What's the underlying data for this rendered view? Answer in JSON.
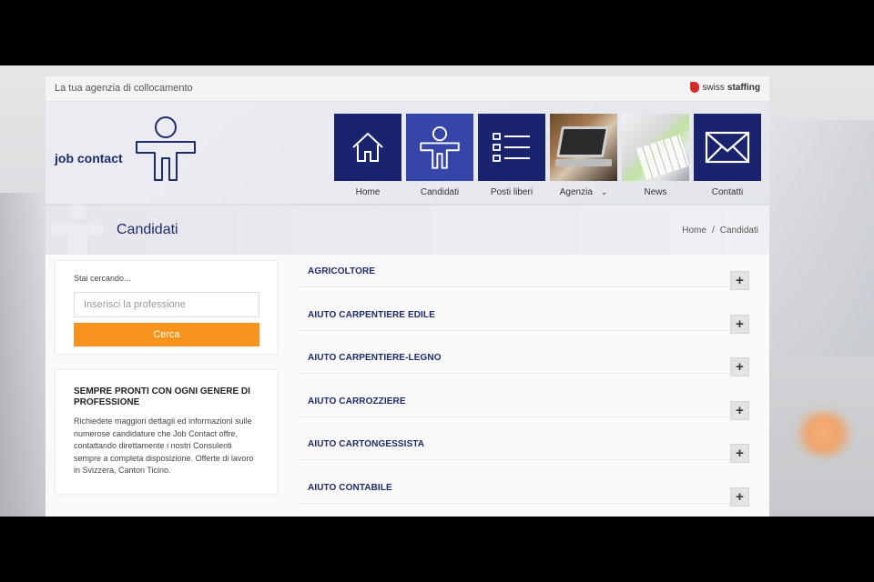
{
  "header": {
    "tagline": "La tua agenzia di collocamento",
    "partner_prefix": "swiss",
    "partner_suffix": "staffing",
    "logo_text": "job contact"
  },
  "nav": [
    {
      "label": "Home",
      "icon": "house-icon"
    },
    {
      "label": "Candidati",
      "icon": "person-icon"
    },
    {
      "label": "Posti liberi",
      "icon": "list-icon"
    },
    {
      "label": "Agenzia",
      "icon": "laptop-photo",
      "dropdown_icon": "chevron-down-icon"
    },
    {
      "label": "News",
      "icon": "keyboard-photo"
    },
    {
      "label": "Contatti",
      "icon": "envelope-icon"
    }
  ],
  "page": {
    "title": "Candidati",
    "breadcrumb": [
      "Home",
      "Candidati"
    ],
    "breadcrumb_separator": "/"
  },
  "search": {
    "label": "Stai cercando...",
    "placeholder": "Inserisci la professione",
    "button": "Cerca"
  },
  "info": {
    "title": "SEMPRE PRONTI CON OGNI GENERE DI PROFESSIONE",
    "text": "Richiedete maggiori dettagli ed informazioni sulle numerose candidature che Job Contact offre, contattando direttamente i nostri Consulenti sempre a completa disposizione. Offerte di lavoro in Svizzera, Canton Ticino."
  },
  "professions": [
    {
      "label": "AGRICOLTORE",
      "toggle": "+"
    },
    {
      "label": "AIUTO CARPENTIERE EDILE",
      "toggle": "+"
    },
    {
      "label": "AIUTO CARPENTIERE-LEGNO",
      "toggle": "+"
    },
    {
      "label": "AIUTO CARROZZIERE",
      "toggle": "+"
    },
    {
      "label": "AIUTO CARTONGESSISTA",
      "toggle": "+"
    },
    {
      "label": "AIUTO CONTABILE",
      "toggle": "+"
    }
  ],
  "colors": {
    "brand_navy": "#1a236e",
    "brand_active": "#3546a8",
    "accent_orange": "#f7941d",
    "partner_red": "#d62b2b"
  }
}
